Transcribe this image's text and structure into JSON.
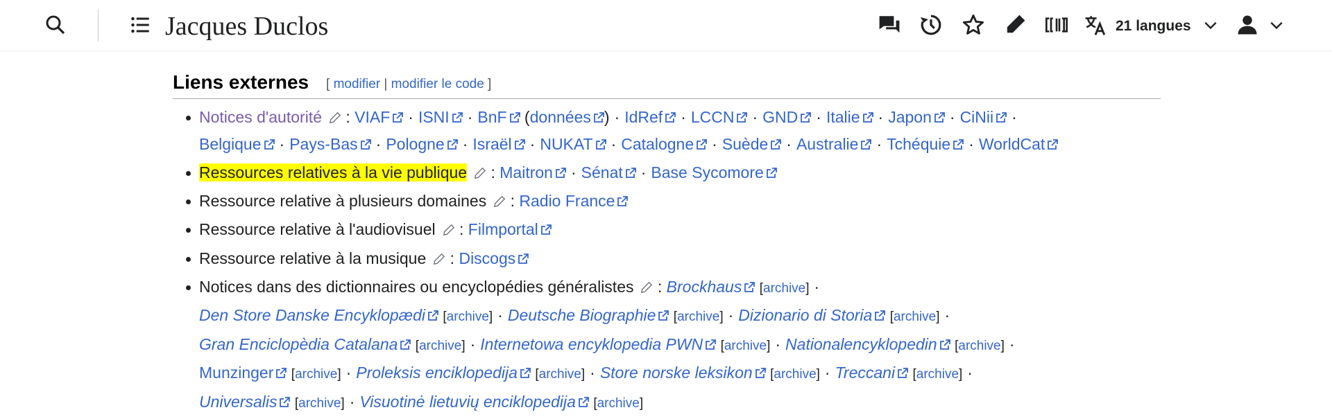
{
  "header": {
    "title": "Jacques Duclos",
    "languages_label": "21 langues",
    "icons": [
      "search-icon",
      "toc-icon",
      "talk-icon",
      "history-icon",
      "watch-star-icon",
      "edit-pencil-icon",
      "wikidata-icon",
      "language-icon",
      "chevron-down-icon",
      "user-icon",
      "chevron-down-icon"
    ]
  },
  "section": {
    "title": "Liens externes",
    "edit_open": "[",
    "edit_modifier": "modifier",
    "edit_sep": "|",
    "edit_modifier_code": "modifier le code",
    "edit_close": "]"
  },
  "rows": {
    "authority": {
      "label": "Notices d'autorité",
      "links": [
        "VIAF",
        "ISNI",
        "BnF",
        "données",
        "IdRef",
        "LCCN",
        "GND",
        "Italie",
        "Japon",
        "CiNii",
        "Belgique",
        "Pays-Bas",
        "Pologne",
        "Israël",
        "NUKAT",
        "Catalogne",
        "Suède",
        "Australie",
        "Tchéquie",
        "WorldCat"
      ]
    },
    "public_life": {
      "label": "Ressources relatives à la vie publique",
      "links": [
        "Maitron",
        "Sénat",
        "Base Sycomore"
      ]
    },
    "multi": {
      "label": "Ressource relative à plusieurs domaines",
      "links": [
        "Radio France"
      ]
    },
    "audiovisual": {
      "label": "Ressource relative à l'audiovisuel",
      "links": [
        "Filmportal"
      ]
    },
    "music": {
      "label": "Ressource relative à la musique",
      "links": [
        "Discogs"
      ]
    },
    "encyclopedias": {
      "label": "Notices dans des dictionnaires ou encyclopédies généralistes",
      "archive": "archive",
      "links": [
        "Brockhaus",
        "Den Store Danske Encyklopædi",
        "Deutsche Biographie",
        "Dizionario di Storia",
        "Gran Enciclopèdia Catalana",
        "Internetowa encyklopedia PWN",
        "Nationalencyklopedin",
        "Munzinger",
        "Proleksis enciklopedija",
        "Store norske leksikon",
        "Treccani",
        "Universalis",
        "Visuotinė lietuvių enciklopedija"
      ]
    }
  },
  "colors": {
    "link": "#3366cc",
    "visited": "#795cb2",
    "highlight": "#ffff00",
    "text": "#202122"
  }
}
